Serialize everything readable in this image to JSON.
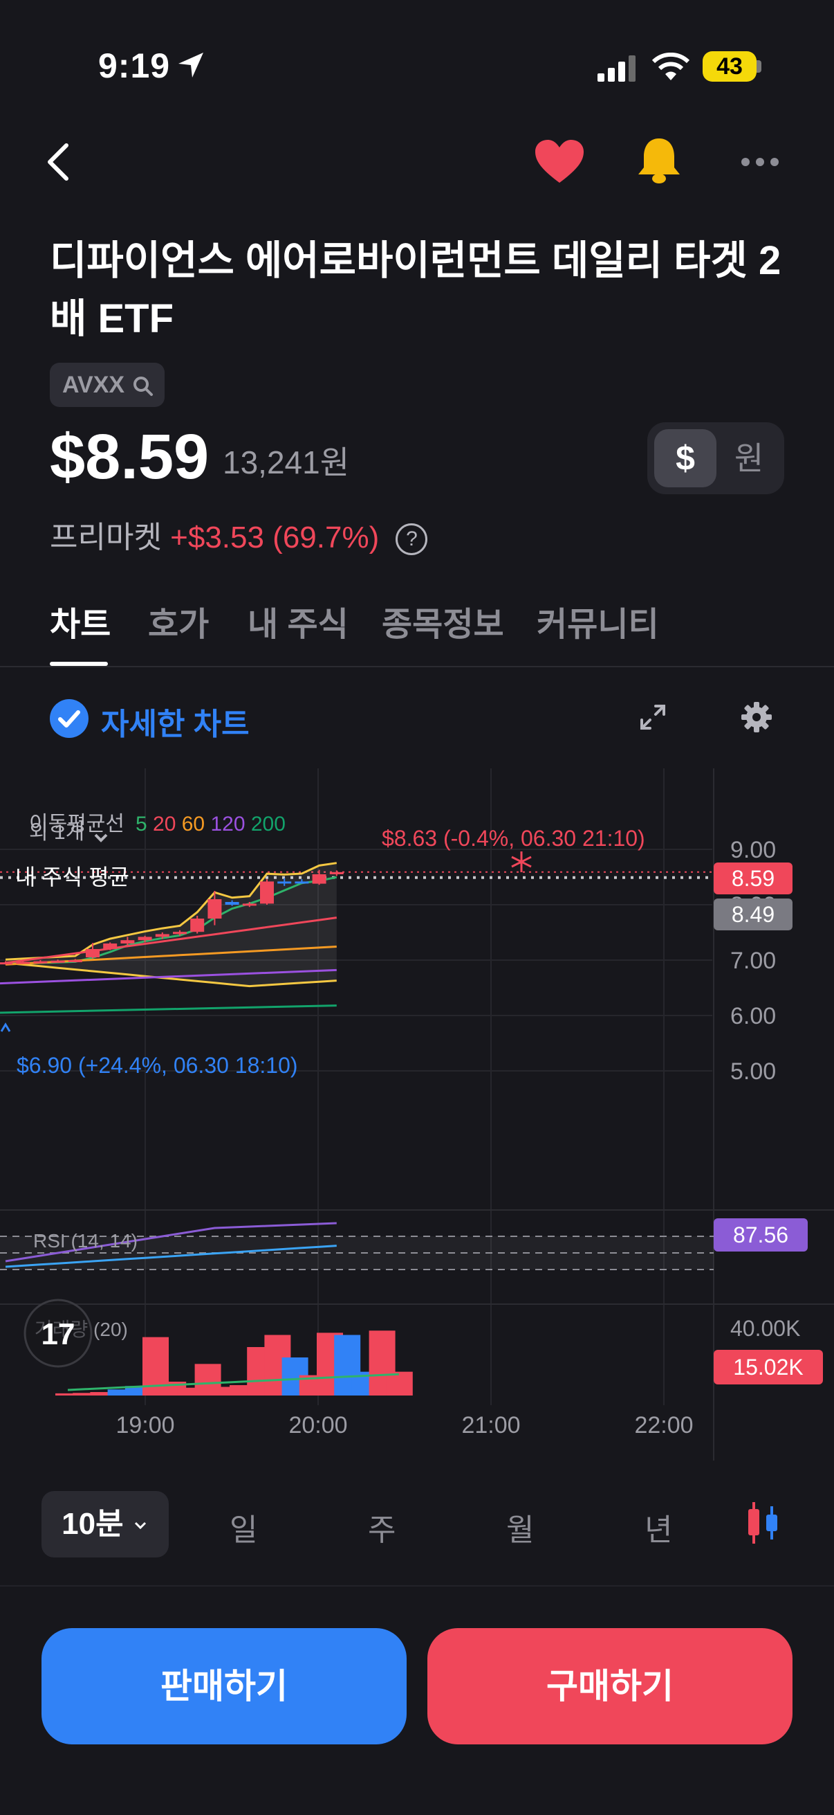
{
  "status_bar": {
    "time": "9:19",
    "battery": "43"
  },
  "stock": {
    "title": "디파이언스 에어로바이런먼트 데일리 타겟 2배 ETF",
    "ticker": "AVXX",
    "price": "$8.59",
    "price_krw": "13,241원",
    "premarket_label": "프리마켓",
    "premarket_change": "+$3.53 (69.7%)"
  },
  "currency_toggle": {
    "usd": "$",
    "krw": "원"
  },
  "tabs": [
    {
      "label": "차트"
    },
    {
      "label": "호가"
    },
    {
      "label": "내 주식"
    },
    {
      "label": "종목정보"
    },
    {
      "label": "커뮤니티"
    }
  ],
  "detail_chart_label": "자세한 차트",
  "chart_data": {
    "type": "candlestick",
    "ma_label": "이동평균선",
    "ma_periods": [
      "5",
      "20",
      "60",
      "120",
      "200"
    ],
    "ma_colors": [
      "#2fb36b",
      "#f0475a",
      "#f59a23",
      "#9b51e0",
      "#12a36b"
    ],
    "extra_label": "외 1개",
    "my_avg_label": "내 주식 평균",
    "high_annotation": "$8.63 (-0.4%, 06.30 21:10)",
    "low_annotation": "$6.90 (+24.4%, 06.30 18:10)",
    "price_badge": "8.59",
    "avg_badge": "8.49",
    "yaxis_ticks": [
      "9.00",
      "8.00",
      "7.00",
      "6.00",
      "5.00"
    ],
    "xaxis_ticks": [
      "19:00",
      "20:00",
      "21:00",
      "22:00"
    ],
    "candles": [
      {
        "o": 6.94,
        "h": 6.98,
        "l": 6.92,
        "c": 6.96
      },
      {
        "o": 6.95,
        "h": 6.99,
        "l": 6.93,
        "c": 6.97
      },
      {
        "o": 6.96,
        "h": 7.0,
        "l": 6.94,
        "c": 6.98
      },
      {
        "o": 6.97,
        "h": 7.01,
        "l": 6.95,
        "c": 6.99
      },
      {
        "o": 6.98,
        "h": 7.02,
        "l": 6.96,
        "c": 7.0
      },
      {
        "o": 7.05,
        "h": 7.31,
        "l": 7.03,
        "c": 7.2
      },
      {
        "o": 7.2,
        "h": 7.32,
        "l": 7.18,
        "c": 7.3
      },
      {
        "o": 7.3,
        "h": 7.42,
        "l": 7.26,
        "c": 7.36
      },
      {
        "o": 7.36,
        "h": 7.44,
        "l": 7.32,
        "c": 7.42
      },
      {
        "o": 7.42,
        "h": 7.5,
        "l": 7.38,
        "c": 7.47
      },
      {
        "o": 7.47,
        "h": 7.54,
        "l": 7.44,
        "c": 7.51
      },
      {
        "o": 7.51,
        "h": 7.8,
        "l": 7.48,
        "c": 7.75
      },
      {
        "o": 7.75,
        "h": 8.25,
        "l": 7.63,
        "c": 8.1
      },
      {
        "o": 8.05,
        "h": 8.08,
        "l": 7.98,
        "c": 8.0
      },
      {
        "o": 8.0,
        "h": 8.05,
        "l": 7.96,
        "c": 8.02
      },
      {
        "o": 8.02,
        "h": 8.46,
        "l": 8.0,
        "c": 8.42
      },
      {
        "o": 8.42,
        "h": 8.48,
        "l": 8.34,
        "c": 8.4
      },
      {
        "o": 8.42,
        "h": 8.46,
        "l": 8.38,
        "c": 8.41
      },
      {
        "o": 8.38,
        "h": 8.63,
        "l": 8.36,
        "c": 8.55
      },
      {
        "o": 8.55,
        "h": 8.62,
        "l": 8.52,
        "c": 8.59
      }
    ],
    "rsi_label": "RSI (14, 14)",
    "rsi_badge": "87.56",
    "volume_label": "거래량 (20)",
    "volume_axis": "40.00K",
    "volume_badge": "15.02K",
    "volumes": [
      0.5,
      0.6,
      0.8,
      1.4,
      2.2,
      13.5,
      3.2,
      1.8,
      7.3,
      2.0,
      2.4,
      11.2,
      14.0,
      8.8,
      4.7,
      14.5,
      14.0,
      5.5,
      15.0,
      5.5
    ],
    "volume_up": [
      true,
      true,
      true,
      false,
      false,
      true,
      true,
      true,
      true,
      true,
      true,
      true,
      true,
      false,
      true,
      true,
      false,
      false,
      true,
      true
    ]
  },
  "timeframes": {
    "selected": "10분",
    "options": [
      "일",
      "주",
      "월",
      "년"
    ]
  },
  "actions": {
    "sell": "판매하기",
    "buy": "구매하기"
  },
  "colors": {
    "up": "#f0475a",
    "down": "#3182f6",
    "background": "#17171c"
  }
}
